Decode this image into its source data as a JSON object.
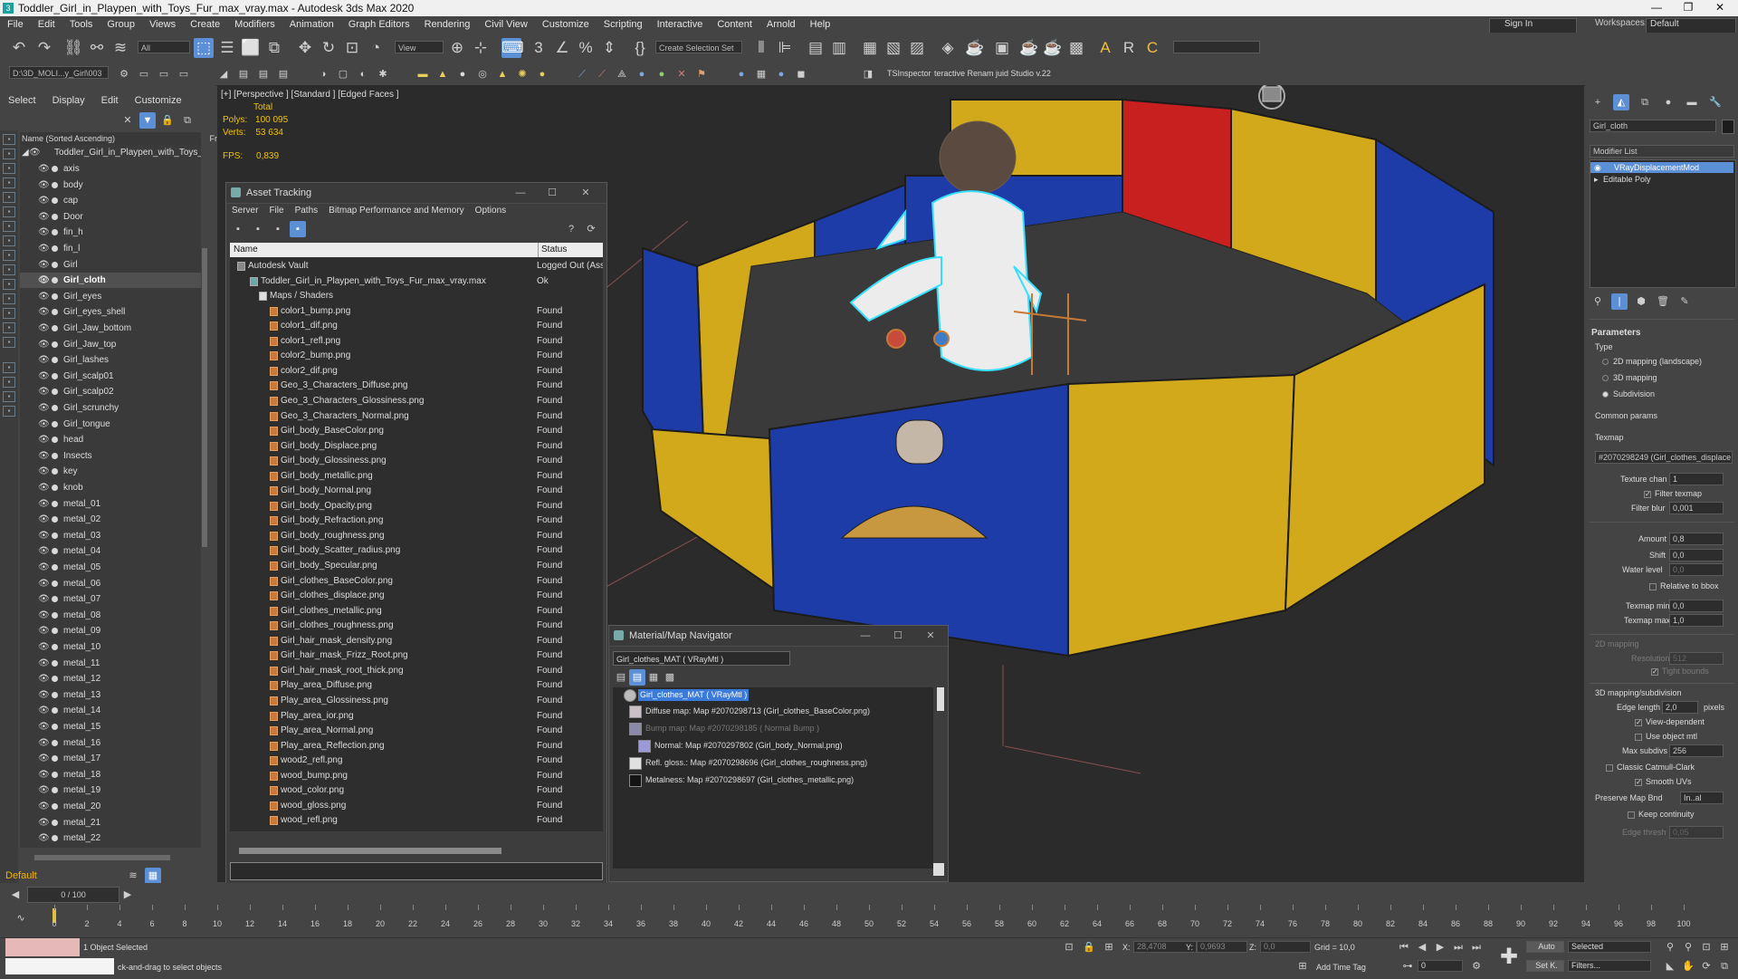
{
  "window": {
    "title": "Toddler_Girl_in_Playpen_with_Toys_Fur_max_vray.max - Autodesk 3ds Max 2020",
    "controls": [
      "—",
      "❐",
      "✕"
    ]
  },
  "menu": [
    "File",
    "Edit",
    "Tools",
    "Group",
    "Views",
    "Create",
    "Modifiers",
    "Animation",
    "Graph Editors",
    "Rendering",
    "Civil View",
    "Customize",
    "Scripting",
    "Interactive",
    "Content",
    "Arnold",
    "Help"
  ],
  "signin": "Sign In",
  "workspaces_label": "Workspaces:",
  "workspace_value": "Default",
  "toolbar": {
    "selection_filter": "All",
    "reference_coord": "View",
    "selection_set": "Create Selection Set",
    "project_path": "D:\\3D_MOLI...y_Girl\\003",
    "ts_inspector": "TSInspector",
    "rename_tool": "teractive Renam juid Studio v.22"
  },
  "explorer": {
    "tabs": [
      "Select",
      "Display",
      "Edit",
      "Customize"
    ],
    "header": "Name (Sorted Ascending)",
    "header_suffix": "Fr",
    "root": "Toddler_Girl_in_Playpen_with_Toys_Fur",
    "items": [
      "axis",
      "body",
      "cap",
      "Door",
      "fin_h",
      "fin_l",
      "Girl",
      "Girl_cloth",
      "Girl_eyes",
      "Girl_eyes_shell",
      "Girl_Jaw_bottom",
      "Girl_Jaw_top",
      "Girl_lashes",
      "Girl_scalp01",
      "Girl_scalp02",
      "Girl_scrunchy",
      "Girl_tongue",
      "head",
      "Insects",
      "key",
      "knob",
      "metal_01",
      "metal_02",
      "metal_03",
      "metal_04",
      "metal_05",
      "metal_06",
      "metal_07",
      "metal_08",
      "metal_09",
      "metal_10",
      "metal_11",
      "metal_12",
      "metal_13",
      "metal_14",
      "metal_15",
      "metal_16",
      "metal_17",
      "metal_18",
      "metal_19",
      "metal_20",
      "metal_21",
      "metal_22"
    ],
    "selected": "Girl_cloth",
    "layer": "Default"
  },
  "viewport": {
    "label": "[+] [Perspective ] [Standard ] [Edged Faces ]",
    "total_label": "Total",
    "polys_label": "Polys:",
    "polys": "100 095",
    "verts_label": "Verts:",
    "verts": "53 634",
    "fps_label": "FPS:",
    "fps": "0,839"
  },
  "asset_tracking": {
    "title": "Asset Tracking",
    "menu": [
      "Server",
      "File",
      "Paths",
      "Bitmap Performance and Memory",
      "Options"
    ],
    "columns": [
      "Name",
      "Status"
    ],
    "vault": {
      "name": "Autodesk Vault",
      "status": "Logged Out (Ass"
    },
    "file": {
      "name": "Toddler_Girl_in_Playpen_with_Toys_Fur_max_vray.max",
      "status": "Ok"
    },
    "group": "Maps / Shaders",
    "files": [
      "color1_bump.png",
      "color1_dif.png",
      "color1_refl.png",
      "color2_bump.png",
      "color2_dif.png",
      "Geo_3_Characters_Diffuse.png",
      "Geo_3_Characters_Glossiness.png",
      "Geo_3_Characters_Normal.png",
      "Girl_body_BaseColor.png",
      "Girl_body_Displace.png",
      "Girl_body_Glossiness.png",
      "Girl_body_metallic.png",
      "Girl_body_Normal.png",
      "Girl_body_Opacity.png",
      "Girl_body_Refraction.png",
      "Girl_body_roughness.png",
      "Girl_body_Scatter_radius.png",
      "Girl_body_Specular.png",
      "Girl_clothes_BaseColor.png",
      "Girl_clothes_displace.png",
      "Girl_clothes_metallic.png",
      "Girl_clothes_roughness.png",
      "Girl_hair_mask_density.png",
      "Girl_hair_mask_Frizz_Root.png",
      "Girl_hair_mask_root_thick.png",
      "Play_area_Diffuse.png",
      "Play_area_Glossiness.png",
      "Play_area_ior.png",
      "Play_area_Normal.png",
      "Play_area_Reflection.png",
      "wood2_refl.png",
      "wood_bump.png",
      "wood_color.png",
      "wood_gloss.png",
      "wood_refl.png"
    ],
    "file_status": "Found"
  },
  "material_navigator": {
    "title": "Material/Map Navigator",
    "field": "Girl_clothes_MAT  ( VRayMtl )",
    "root": "Girl_clothes_MAT  ( VRayMtl )",
    "entries": [
      {
        "text": "Diffuse map: Map #2070298713 (Girl_clothes_BaseColor.png)",
        "dim": false
      },
      {
        "text": "Bump map: Map #2070298185  ( Normal Bump )",
        "dim": true
      },
      {
        "text": "Normal: Map #2070297802 (Girl_body_Normal.png)",
        "dim": false
      },
      {
        "text": "Refl. gloss.: Map #2070298696 (Girl_clothes_roughness.png)",
        "dim": false
      },
      {
        "text": "Metalness: Map #2070298697 (Girl_clothes_metallic.png)",
        "dim": false
      }
    ]
  },
  "command_panel": {
    "object_name": "Girl_cloth",
    "modifier_list": "Modifier List",
    "stack": [
      "VRayDisplacementMod",
      "Editable Poly"
    ],
    "parameters": "Parameters",
    "type_label": "Type",
    "types": [
      "2D mapping (landscape)",
      "3D mapping",
      "Subdivision"
    ],
    "common_params": "Common params",
    "texmap_label": "Texmap",
    "texmap": "#2070298249 (Girl_clothes_displace",
    "texture_chan_label": "Texture chan",
    "texture_chan": "1",
    "filter_texmap": "Filter texmap",
    "filter_blur_label": "Filter blur",
    "filter_blur": "0,001",
    "amount_label": "Amount",
    "amount": "0,8",
    "shift_label": "Shift",
    "shift": "0,0",
    "water_level_label": "Water level",
    "water_level": "0,0",
    "relative_bbox": "Relative to bbox",
    "texmap_min_label": "Texmap min",
    "texmap_min": "0,0",
    "texmap_max_label": "Texmap max",
    "texmap_max": "1,0",
    "mapping_2d": "2D mapping",
    "resolution_label": "Resolution",
    "resolution": "512",
    "tight_bounds": "Tight bounds",
    "mapping_3d": "3D mapping/subdivision",
    "edge_length_label": "Edge length",
    "edge_length": "2,0",
    "pixels": "pixels",
    "view_dependent": "View-dependent",
    "use_object_mtl": "Use object mtl",
    "max_subdivs_label": "Max subdivs",
    "max_subdivs": "256",
    "classic_catmull": "Classic Catmull-Clark",
    "smooth_uvs": "Smooth UVs",
    "preserve_map_bnd_label": "Preserve Map Bnd",
    "preserve_map_bnd": "In..al",
    "keep_continuity": "Keep continuity",
    "edge_thresh_label": "Edge thresh",
    "edge_thresh": "0,05"
  },
  "timeline": {
    "slider": "0 / 100",
    "ticks": [
      "0",
      "2",
      "4",
      "6",
      "8",
      "10",
      "12",
      "14",
      "16",
      "18",
      "20",
      "22",
      "24",
      "26",
      "28",
      "30",
      "32",
      "34",
      "36",
      "38",
      "40",
      "42",
      "44",
      "46",
      "48",
      "50",
      "52",
      "54",
      "56",
      "58",
      "60",
      "62",
      "64",
      "66",
      "68",
      "70",
      "72",
      "74",
      "76",
      "78",
      "80",
      "82",
      "84",
      "86",
      "88",
      "90",
      "92",
      "94",
      "96",
      "98",
      "100"
    ]
  },
  "status": {
    "selection": "1 Object Selected",
    "prompt": "ck-and-drag to select objects",
    "x_label": "X:",
    "x": "28,4708",
    "y_label": "Y:",
    "y": "0,9693",
    "z_label": "Z:",
    "z": "0,0",
    "grid": "Grid = 10,0",
    "add_time_tag": "Add Time Tag",
    "auto": "Auto",
    "set_k": "Set K.",
    "selected": "Selected",
    "filters": "Filters...",
    "frame": "0"
  }
}
